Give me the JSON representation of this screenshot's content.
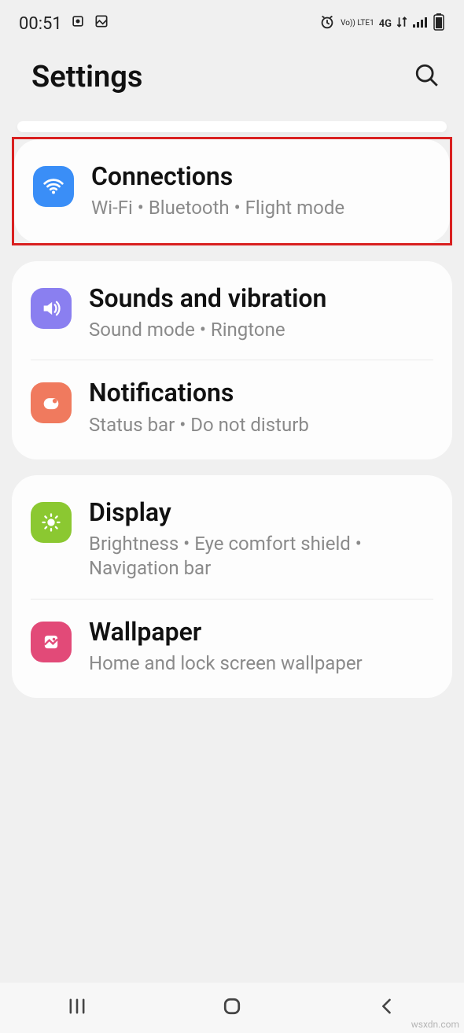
{
  "status": {
    "time": "00:51",
    "network": "4G",
    "lte": "Vo)) LTE1"
  },
  "header": {
    "title": "Settings"
  },
  "groups": [
    {
      "highlight": true,
      "items": [
        {
          "icon": "wifi",
          "color": "icon-blue",
          "title": "Connections",
          "subtitle": "Wi‑Fi  •  Bluetooth  •  Flight mode"
        }
      ]
    },
    {
      "items": [
        {
          "icon": "sound",
          "color": "icon-purple",
          "title": "Sounds and vibration",
          "subtitle": "Sound mode  •  Ringtone"
        },
        {
          "icon": "notif",
          "color": "icon-orange",
          "title": "Notifications",
          "subtitle": "Status bar  •  Do not disturb"
        }
      ]
    },
    {
      "items": [
        {
          "icon": "display",
          "color": "icon-green",
          "title": "Display",
          "subtitle": "Brightness  •  Eye comfort shield  •  Navigation bar"
        },
        {
          "icon": "wallpaper",
          "color": "icon-pink",
          "title": "Wallpaper",
          "subtitle": "Home and lock screen wallpaper"
        }
      ]
    }
  ],
  "watermark": "wsxdn.com"
}
